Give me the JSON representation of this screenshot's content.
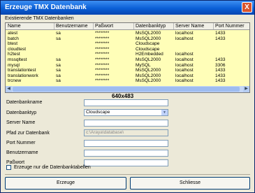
{
  "window": {
    "title": "Erzeuge TMX Datenbank",
    "close_glyph": "X"
  },
  "section_label": "Existierende TMX Datenbanken",
  "resolution_badge": "640x483",
  "table": {
    "columns": [
      "Name",
      "Benutzername",
      "Paßwort",
      "Datenbanktyp",
      "Server Name",
      "Port Nummer"
    ],
    "rows": [
      [
        "atest",
        "sa",
        "********",
        "MsSQL2000",
        "localhost",
        "1433"
      ],
      [
        "batch",
        "sa",
        "********",
        "MsSQL2000",
        "localhost",
        "1433"
      ],
      [
        "btest",
        "",
        "********",
        "Cloudscape",
        "",
        ""
      ],
      [
        "cloudtest",
        "",
        "********",
        "Cloudscape",
        "",
        ""
      ],
      [
        "h2test",
        "",
        "********",
        "H2Embedded",
        "localhost",
        ""
      ],
      [
        "mssqltest",
        "sa",
        "********",
        "MsSQL2000",
        "localhost",
        "1433"
      ],
      [
        "mysql",
        "sa",
        "********",
        "MySQL",
        "localhost",
        "3306"
      ],
      [
        "translationtest",
        "sa",
        "********",
        "MsSQL2000",
        "localhost",
        "1433"
      ],
      [
        "translationwork",
        "sa",
        "********",
        "MsSQL2000",
        "localhost",
        "1433"
      ],
      [
        "trcnew",
        "sa",
        "********",
        "MsSQL2000",
        "localhost",
        "1433"
      ]
    ]
  },
  "form": {
    "db_name_label": "Datenbankname",
    "db_name_value": "",
    "db_type_label": "Datenbanktyp",
    "db_type_value": "Cloudscape",
    "server_label": "Server Name",
    "server_value": "",
    "path_label": "Pfad zur Datenbank",
    "path_value": "c:\\Araya\\database\\",
    "port_label": "Port Nummer",
    "port_value": "",
    "user_label": "Benutzername",
    "user_value": "",
    "password_label": "Paßwort",
    "password_value": "",
    "tables_only_label": "Erzeuge nur die Datenbanktabellen",
    "tables_only_checked": false
  },
  "buttons": {
    "create": "Erzeuge",
    "close": "Schliesse"
  }
}
